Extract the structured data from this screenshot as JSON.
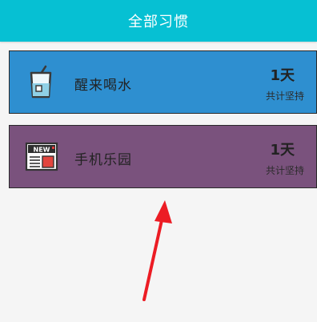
{
  "header": {
    "title": "全部习惯"
  },
  "colors": {
    "header_bg": "#06c0d3",
    "card_blue": "#2e8fd0",
    "card_purple": "#7a527d",
    "annotation_arrow": "#ec1c24"
  },
  "habits": [
    {
      "name": "醒来喝水",
      "days": "1天",
      "total_label": "共计坚持",
      "icon": "glass-of-water-icon",
      "color": "#2e8fd0"
    },
    {
      "name": "手机乐园",
      "days": "1天",
      "total_label": "共计坚持",
      "icon": "newspaper-icon",
      "color": "#7a527d"
    }
  ]
}
